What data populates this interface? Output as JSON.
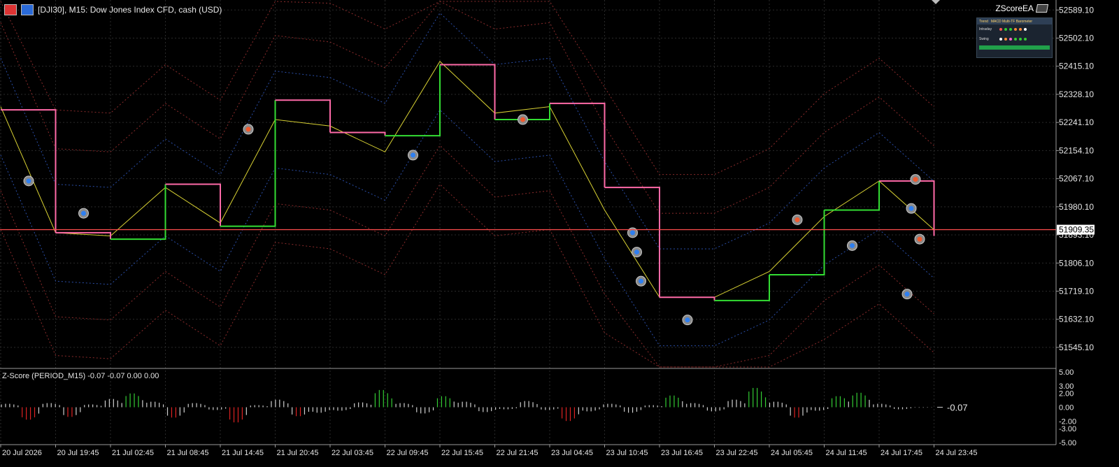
{
  "window": {
    "title": "[DJI30], M15:  Dow Jones Index CFD, cash (USD)",
    "ea_name": "ZScoreEA"
  },
  "colors": {
    "background": "#000000",
    "grid": "#2a2a2a",
    "price_line": "#d9d233",
    "trend_up": "#33dd33",
    "trend_down": "#ff6aa8",
    "bid_line": "#ff4d4d",
    "band_dotted_blue": "#2a4ea8",
    "band_dotted_red": "#8a2b2b",
    "zscore_pos": "#33cc33",
    "zscore_neg": "#dd2222",
    "axis_text": "#e6e6e6"
  },
  "price_axis": {
    "labels": [
      "52589.10",
      "52502.10",
      "52415.10",
      "52328.10",
      "52241.10",
      "52154.10",
      "52067.10",
      "51980.10",
      "51893.10",
      "51806.10",
      "51719.10",
      "51632.10",
      "51545.10"
    ],
    "current_price": "51909.35"
  },
  "time_axis": {
    "labels": [
      "20 Jul 2026",
      "20 Jul 19:45",
      "21 Jul 02:45",
      "21 Jul 08:45",
      "21 Jul 14:45",
      "21 Jul 20:45",
      "22 Jul 03:45",
      "22 Jul 09:45",
      "22 Jul 15:45",
      "22 Jul 21:45",
      "23 Jul 04:45",
      "23 Jul 10:45",
      "23 Jul 16:45",
      "23 Jul 22:45",
      "24 Jul 05:45",
      "24 Jul 11:45",
      "24 Jul 17:45",
      "24 Jul 23:45"
    ]
  },
  "zscore": {
    "label": "Z-Score (PERIOD_M15) -0.07 -0.07 0.00 0.00",
    "axis_labels": [
      "5.00",
      "3.00",
      "2.00",
      "0.00",
      "-2.00",
      "-3.00",
      "-5.00"
    ],
    "current": "-0.07"
  },
  "mtf_panel": {
    "title_left": "Trend",
    "title_right": "MACD Multi-TF Barometer",
    "rows": [
      {
        "label": "Intraday",
        "dots": [
          "#ff5555",
          "#33cc33",
          "#33cc33",
          "#ff8a3a",
          "#ff8a3a",
          "#ffffff"
        ]
      },
      {
        "label": "Swing",
        "dots": [
          "#ffffff",
          "#ff8a3a",
          "#ff66cc",
          "#33cc33",
          "#33cc33",
          "#33cc33"
        ]
      }
    ]
  },
  "chart_data": {
    "type": "line",
    "title": "[DJI30], M15:  Dow Jones Index CFD, cash (USD)",
    "ylim": [
      51480,
      52620
    ],
    "x": [
      "20 Jul 2026",
      "20 Jul 19:45",
      "21 Jul 02:45",
      "21 Jul 08:45",
      "21 Jul 14:45",
      "21 Jul 20:45",
      "22 Jul 03:45",
      "22 Jul 09:45",
      "22 Jul 15:45",
      "22 Jul 21:45",
      "23 Jul 04:45",
      "23 Jul 10:45",
      "23 Jul 16:45",
      "23 Jul 22:45",
      "24 Jul 05:45",
      "24 Jul 11:45",
      "24 Jul 17:45",
      "24 Jul 23:45"
    ],
    "series": [
      {
        "name": "",
        "x": [
          "20 Jul 2026",
          "20 Jul 19:45",
          "21 Jul 02:45",
          "21 Jul 08:45",
          "21 Jul 14:45",
          "21 Jul 20:45",
          "22 Jul 03:45",
          "22 Jul 09:45",
          "22 Jul 15:45",
          "22 Jul 21:45",
          "23 Jul 04:45",
          "23 Jul 10:45",
          "23 Jul 16:45",
          "23 Jul 22:45",
          "24 Jul 05:45",
          "24 Jul 11:45",
          "24 Jul 17:45",
          "24 Jul 23:45"
        ],
        "values": [
          52290,
          51900,
          51890,
          52040,
          51930,
          52250,
          52230,
          52150,
          52430,
          52270,
          52290,
          51970,
          51700,
          51700,
          51780,
          51950,
          52060,
          51909
        ]
      },
      {
        "name": "",
        "x": [
          "20 Jul 2026",
          "20 Jul 19:45",
          "21 Jul 02:45",
          "21 Jul 08:45",
          "21 Jul 14:45",
          "21 Jul 20:45",
          "22 Jul 03:45",
          "22 Jul 09:45",
          "22 Jul 15:45",
          "22 Jul 21:45",
          "23 Jul 04:45",
          "23 Jul 10:45",
          "23 Jul 16:45",
          "23 Jul 22:45",
          "24 Jul 05:45",
          "24 Jul 11:45",
          "24 Jul 17:45",
          "24 Jul 23:45"
        ],
        "values": [
          52280,
          51900,
          51880,
          52050,
          51920,
          52310,
          52210,
          52200,
          52420,
          52250,
          52300,
          52040,
          51700,
          51690,
          51770,
          51970,
          52060,
          51890
        ]
      }
    ],
    "signals": [
      {
        "x": "20 Jul 2026",
        "value": 52060,
        "dir": "buy"
      },
      {
        "x": "20 Jul 19:45",
        "value": 51960,
        "dir": "buy"
      },
      {
        "x": "21 Jul 14:45",
        "value": 52220,
        "dir": "sell"
      },
      {
        "x": "22 Jul 09:45",
        "value": 52140,
        "dir": "buy"
      },
      {
        "x": "22 Jul 21:45",
        "value": 52250,
        "dir": "sell"
      },
      {
        "x": "23 Jul 10:45",
        "value": 51900,
        "dir": "buy"
      },
      {
        "x": "23 Jul 10:45",
        "value": 51840,
        "dir": "buy"
      },
      {
        "x": "23 Jul 10:45",
        "value": 51750,
        "dir": "buy"
      },
      {
        "x": "23 Jul 16:45",
        "value": 51630,
        "dir": "buy"
      },
      {
        "x": "24 Jul 05:45",
        "value": 51940,
        "dir": "sell"
      },
      {
        "x": "24 Jul 11:45",
        "value": 51860,
        "dir": "buy"
      },
      {
        "x": "24 Jul 17:45",
        "value": 51710,
        "dir": "buy"
      },
      {
        "x": "24 Jul 17:45",
        "value": 51975,
        "dir": "buy"
      },
      {
        "x": "24 Jul 17:45",
        "value": 52065,
        "dir": "sell"
      },
      {
        "x": "24 Jul 17:45",
        "value": 51880,
        "dir": "sell"
      }
    ],
    "zscore_values": [
      0.5,
      -1.8,
      0.6,
      -1.4,
      0.4,
      1.2,
      2.0,
      0.8,
      -1.5,
      0.6,
      -0.4,
      -2.2,
      0.3,
      1.1,
      -1.3,
      -0.8,
      -0.5,
      0.7,
      2.5,
      0.6,
      -0.9,
      1.6,
      0.8,
      -0.7,
      -0.3,
      0.9,
      -0.4,
      -2.0,
      -0.6,
      0.5,
      -0.8,
      0.3,
      1.7,
      0.6,
      -0.6,
      1.1,
      2.8,
      0.8,
      -1.5,
      -0.5,
      1.6,
      2.1,
      0.5,
      -0.3,
      -0.07
    ]
  }
}
